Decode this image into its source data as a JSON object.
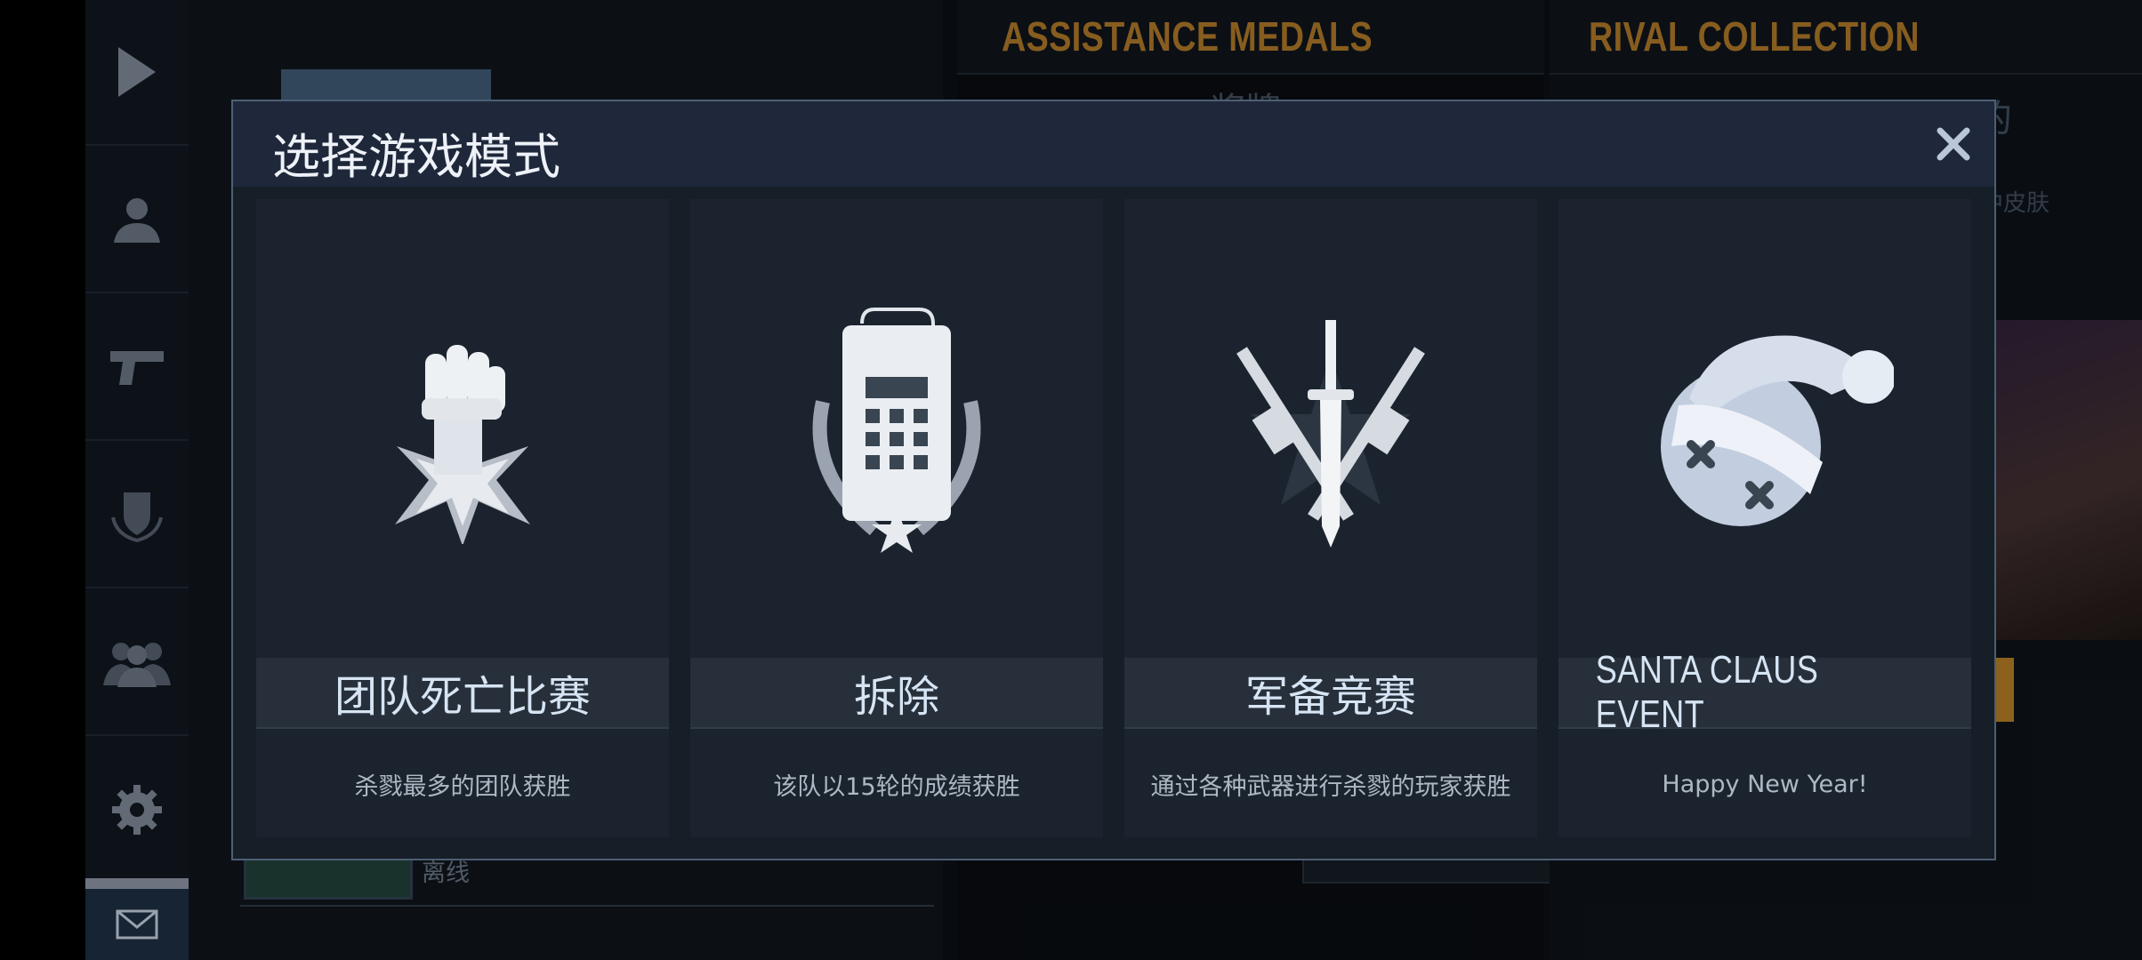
{
  "background": {
    "mid_title": "ASSISTANCE MEDALS",
    "right_title": "RIVAL COLLECTION",
    "mid_faded_text": "奖牌",
    "right_faded_text": "行在宝物上打敌我们的",
    "right_faded_sub": "中皮肤",
    "friend_status": "离线"
  },
  "modal": {
    "title": "选择游戏模式",
    "close_icon": "close-icon",
    "modes": [
      {
        "icon": "fist-star-icon",
        "label": "团队死亡比赛",
        "description": "杀戮最多的团队获胜"
      },
      {
        "icon": "bomb-laurel-icon",
        "label": "拆除",
        "description": "该队以15轮的成绩获胜"
      },
      {
        "icon": "knife-rifles-icon",
        "label": "军备竞赛",
        "description": "通过各种武器进行杀戮的玩家获胜"
      },
      {
        "icon": "santa-hat-snowball-icon",
        "label": "SANTA CLAUS EVENT",
        "description": "Happy New Year!"
      }
    ]
  },
  "sidebar": {
    "items": [
      "play-icon",
      "profile-icon",
      "pistol-icon",
      "clan-shield-icon",
      "friends-icon",
      "settings-gear-icon",
      "mail-icon"
    ]
  },
  "colors": {
    "accent_gold": "#9a6a24",
    "modal_bg": "#161e28",
    "card_bg": "#1b242e",
    "label_text": "#d6e4f4"
  }
}
